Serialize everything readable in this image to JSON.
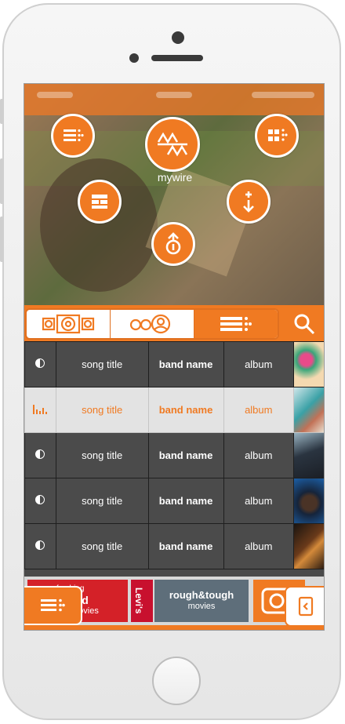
{
  "app": {
    "name": "mywire",
    "accent": "#f07a22"
  },
  "hero": {
    "label": "mywire"
  },
  "songs": [
    {
      "title": "song title",
      "band": "band name",
      "album": "album",
      "state": "paused"
    },
    {
      "title": "song title",
      "band": "band name",
      "album": "album",
      "state": "playing"
    },
    {
      "title": "song title",
      "band": "band name",
      "album": "album",
      "state": "paused"
    },
    {
      "title": "song title",
      "band": "band name",
      "album": "album",
      "state": "paused"
    },
    {
      "title": "song title",
      "band": "band name",
      "album": "album",
      "state": "paused"
    }
  ],
  "ads": {
    "ad1": {
      "l1": "refreshing",
      "l2": "el good",
      "l3": "movies"
    },
    "ad2": {
      "l1": "Levi's"
    },
    "ad3": {
      "l1": "rough&tough",
      "l2": "movies"
    }
  },
  "icons": [
    "playlist-icon",
    "mywire-logo-icon",
    "grid-icon",
    "layout-icon",
    "download-icon",
    "upload-icon",
    "speaker-icon",
    "users-icon",
    "list-icon",
    "search-icon",
    "menu-icon",
    "collapse-icon"
  ]
}
